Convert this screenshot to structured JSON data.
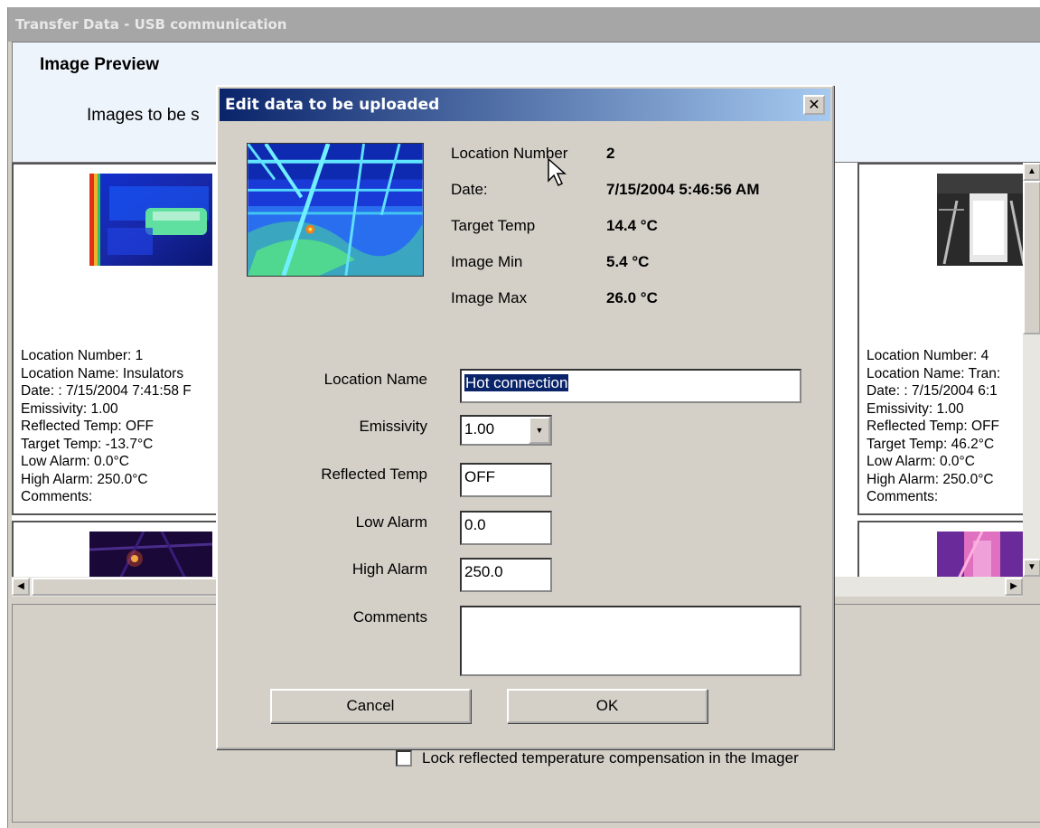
{
  "window": {
    "title": "Transfer Data - USB communication"
  },
  "header": {
    "title": "Image Preview",
    "subtitle": "Images to be s"
  },
  "cards": [
    {
      "info": "Location Number: 1\nLocation Name: Insulators\nDate: : 7/15/2004 7:41:58 F\nEmissivity: 1.00\nReflected Temp: OFF\nTarget Temp: -13.7°C\nLow Alarm: 0.0°C\nHigh Alarm: 250.0°C\nComments:"
    },
    {
      "info": "Location Number: 4\nLocation Name: Tran:\nDate: : 7/15/2004 6:1\nEmissivity: 1.00\nReflected Temp: OFF\nTarget Temp: 46.2°C\nLow Alarm: 0.0°C\nHigh Alarm: 250.0°C\nComments:"
    }
  ],
  "lower": {
    "checkbox_label": "Lock reflected temperature compensation in the Imager",
    "checked": false
  },
  "dialog": {
    "title": "Edit data to be uploaded",
    "close_symbol": "✕",
    "summary": {
      "location_number_label": "Location Number",
      "location_number": "2",
      "date_label": "Date:",
      "date": "7/15/2004 5:46:56 AM",
      "target_temp_label": "Target Temp",
      "target_temp": "14.4 °C",
      "image_min_label": "Image Min",
      "image_min": "5.4 °C",
      "image_max_label": "Image Max",
      "image_max": "26.0 °C"
    },
    "form": {
      "location_name_label": "Location Name",
      "location_name": "Hot connection",
      "emissivity_label": "Emissivity",
      "emissivity": "1.00",
      "reflected_temp_label": "Reflected Temp",
      "reflected_temp": "OFF",
      "low_alarm_label": "Low Alarm",
      "low_alarm": "0.0",
      "high_alarm_label": "High Alarm",
      "high_alarm": "250.0",
      "comments_label": "Comments",
      "comments": ""
    },
    "buttons": {
      "cancel": "Cancel",
      "ok": "OK"
    }
  },
  "icons": {
    "close": "close-icon",
    "scroll_up": "arrow-up-icon",
    "scroll_down": "arrow-down-icon",
    "scroll_left": "arrow-left-icon",
    "scroll_right": "arrow-right-icon",
    "dropdown": "chevron-down-icon",
    "cursor": "mouse-pointer-icon"
  },
  "colors": {
    "dialog_title_start": "#0a246a",
    "dialog_title_end": "#a6caf0",
    "header_bg": "#eef4fc",
    "selection": "#0a246a"
  }
}
